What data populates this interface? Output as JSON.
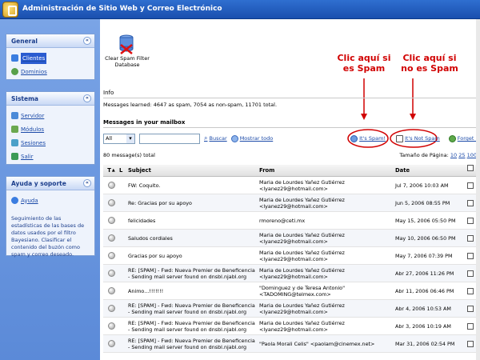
{
  "app": {
    "title": "Administración de Sitio Web y Correo Electrónico"
  },
  "sidebar": {
    "general": {
      "title": "General",
      "items": [
        {
          "label": "Clientes"
        },
        {
          "label": "Dominios"
        }
      ]
    },
    "sistema": {
      "title": "Sistema",
      "items": [
        {
          "label": "Servidor"
        },
        {
          "label": "Módulos"
        },
        {
          "label": "Sesiones"
        },
        {
          "label": "Salir"
        }
      ]
    },
    "ayuda": {
      "title": "Ayuda y soporte",
      "link": "Ayuda",
      "description": "Seguimiento de las estadísticas de las bases de datos usados por el filtro Bayesiano. Clasificar el contenido del buzón como spam y correo deseado."
    }
  },
  "main": {
    "clear_spam_label": "Clear Spam Filter Database",
    "callout_spam": "Clic aquí si es Spam",
    "callout_not_spam": "Clic aquí si no es Spam",
    "info_header": "Info",
    "info_text": "Messages learned: 4647 as spam, 7054 as non-spam, 11701 total.",
    "mailbox_header": "Messages in your mailbox",
    "filter_select": "All",
    "search_value": "",
    "search_label": "Buscar",
    "show_all_label": "Mostrar todo",
    "its_spam_label": "It's Spam!",
    "its_not_spam_label": "It's Not Spam",
    "forget_label": "Forget It",
    "message_count": "80 message(s) total",
    "page_size_label": "Tamaño de Página:",
    "page_sizes": [
      "10",
      "25",
      "100"
    ],
    "columns": {
      "t": "T",
      "a": "▲",
      "l": "L",
      "subject": "Subject",
      "from": "From",
      "date": "Date"
    },
    "messages": [
      {
        "subject": "FW: Coquito.",
        "from": "Maria de Lourdes Yañez Gutiérrez <lyanez29@hotmail.com>",
        "date": "Jul 7, 2006 10:03 AM"
      },
      {
        "subject": "Re: Gracias por su apoyo",
        "from": "Maria de Lourdes Yañez Gutiérrez <lyanez29@hotmail.com>",
        "date": "Jun 5, 2006 08:55 PM"
      },
      {
        "subject": "felicidades",
        "from": "rmoreno@ceti.mx",
        "date": "May 15, 2006 05:50 PM"
      },
      {
        "subject": "Saludos cordiales",
        "from": "Maria de Lourdes Yañez Gutiérrez <lyanez29@hotmail.com>",
        "date": "May 10, 2006 06:50 PM"
      },
      {
        "subject": "Gracias por su apoyo",
        "from": "Maria de Lourdes Yañez Gutiérrez <lyanez29@hotmail.com>",
        "date": "May 7, 2006 07:39 PM"
      },
      {
        "subject": "RE: [SPAM] - Fwd: Nueva Premier de Beneficencia - Sending mail server found on dnsbl.njabl.org",
        "from": "Maria de Lourdes Yañez Gutiérrez <lyanez29@hotmail.com>",
        "date": "Abr 27, 2006 11:26 PM"
      },
      {
        "subject": "Animo...!!!!!!!",
        "from": "\"Dominguez y de Teresa Antonio\" <TADOMING@telmex.com>",
        "date": "Abr 11, 2006 06:46 PM"
      },
      {
        "subject": "RE: [SPAM] - Fwd: Nueva Premier de Beneficencia - Sending mail server found on dnsbl.njabl.org",
        "from": "Maria de Lourdes Yañez Gutiérrez <lyanez29@hotmail.com>",
        "date": "Abr 4, 2006 10:53 AM"
      },
      {
        "subject": "RE: [SPAM] - Fwd: Nueva Premier de Beneficencia - Sending mail server found on dnsbl.njabl.org",
        "from": "Maria de Lourdes Yañez Gutiérrez <lyanez29@hotmail.com>",
        "date": "Abr 3, 2006 10:19 AM"
      },
      {
        "subject": "RE: [SPAM] - Fwd: Nueva Premier de Beneficencia - Sending mail server found on dnsbl.njabl.org",
        "from": "\"Paola Morali Celis\" <paolam@cinemex.net>",
        "date": "Mar 31, 2006 02:54 PM"
      }
    ]
  },
  "colors": {
    "accent": "#1a4fae",
    "callout": "#d10000",
    "link": "#1b4aa8",
    "sidebar": "#6a97dd"
  }
}
